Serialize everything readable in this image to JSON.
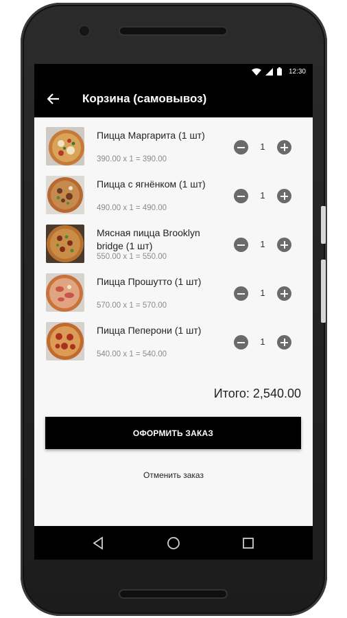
{
  "status_bar": {
    "time": "12:30"
  },
  "app_bar": {
    "title": "Корзина (самовывоз)",
    "back_icon": "arrow-left-icon"
  },
  "cart": {
    "items": [
      {
        "name": "Пицца Маргарита (1 шт)",
        "price_line": "390.00 x 1 = 390.00",
        "quantity": "1"
      },
      {
        "name": "Пицца с ягнёнком (1 шт)",
        "price_line": "490.00 x 1 = 490.00",
        "quantity": "1"
      },
      {
        "name": "Мясная пицца Brooklyn bridge (1 шт)",
        "price_line": "550.00 x 1 = 550.00",
        "quantity": "1"
      },
      {
        "name": "Пицца Прошутто (1 шт)",
        "price_line": "570.00 x 1 = 570.00",
        "quantity": "1"
      },
      {
        "name": "Пицца Пеперони (1 шт)",
        "price_line": "540.00 x 1 = 540.00",
        "quantity": "1"
      }
    ],
    "total": "Итого: 2,540.00",
    "order_button": "ОФОРМИТЬ ЗАКАЗ",
    "cancel_link": "Отменить заказ"
  },
  "colors": {
    "primary": "#000000",
    "background": "#f7f7f7",
    "muted_text": "#8a8a8a",
    "qty_button": "#6a6a6a"
  }
}
